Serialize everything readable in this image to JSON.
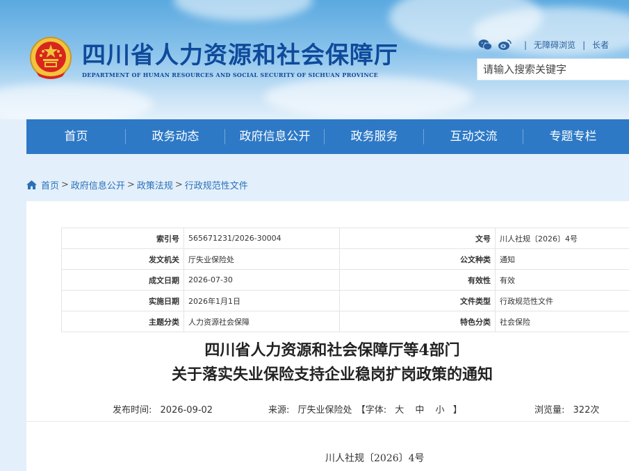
{
  "header": {
    "site_title": "四川省人力资源和社会保障厅",
    "site_subtitle": "DEPARTMENT OF HUMAN RESOURCES AND SOCIAL SECURITY OF SICHUAN PROVINCE",
    "emblem_icon": "national-emblem-icon",
    "utils": {
      "wechat_icon": "wechat-icon",
      "weibo_icon": "weibo-icon",
      "accessibility": "无障碍浏览",
      "elderly": "长者"
    },
    "search_placeholder": "请输入搜索关键字"
  },
  "nav": {
    "items": [
      "首页",
      "政务动态",
      "政府信息公开",
      "政务服务",
      "互动交流",
      "专题专栏"
    ]
  },
  "breadcrumb": {
    "home_icon": "home-icon",
    "items": [
      "首页",
      "政府信息公开",
      "政策法规",
      "行政规范性文件"
    ],
    "separator": ">"
  },
  "info": {
    "rows": [
      {
        "k1": "索引号",
        "v1": "565671231/2026-30004",
        "k2": "文号",
        "v2": "川人社规〔2026〕4号"
      },
      {
        "k1": "发文机关",
        "v1": "厅失业保险处",
        "k2": "公文种类",
        "v2": "通知"
      },
      {
        "k1": "成文日期",
        "v1": "2026-07-30",
        "k2": "有效性",
        "v2": "有效"
      },
      {
        "k1": "实施日期",
        "v1": "2026年1月1日",
        "k2": "文件类型",
        "v2": "行政规范性文件"
      },
      {
        "k1": "主题分类",
        "v1": "人力资源社会保障",
        "k2": "特色分类",
        "v2": "社会保险"
      }
    ]
  },
  "article": {
    "title_line1": "四川省人力资源和社会保障厅等4部门",
    "title_line2": "关于落实失业保险支持企业稳岗扩岗政策的通知",
    "publish_label": "发布时间:",
    "publish_date": "2026-09-02",
    "source_label": "来源:",
    "source_value": "厅失业保险处",
    "font_label": "【字体:",
    "font_large": "大",
    "font_medium": "中",
    "font_small": "小",
    "font_close": "】",
    "views_label": "浏览量:",
    "views_value": "322次",
    "doc_number": "川人社规〔2026〕4号"
  },
  "colors": {
    "nav_blue": "#2d79c6",
    "title_blue": "#0f4a9a",
    "link_blue": "#2a6fb8",
    "page_bg": "#e3f0fb"
  }
}
